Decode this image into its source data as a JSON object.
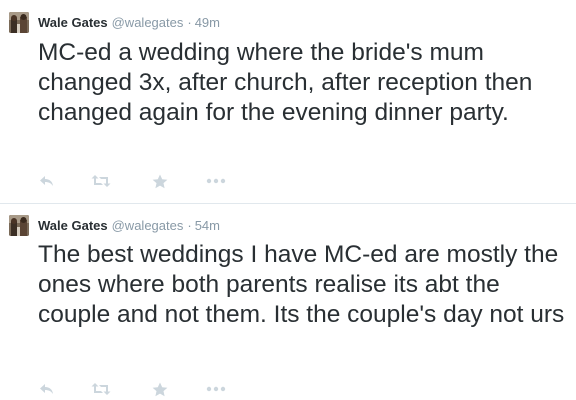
{
  "tweets": [
    {
      "fullname": "Wale Gates",
      "username": "@walegates",
      "separator": "·",
      "time": "49m",
      "text": "MC-ed a wedding where the bride's mum changed 3x, after church, after reception then changed again for the evening dinner party.",
      "actions": [
        "reply-icon",
        "retweet-icon",
        "favorite-icon",
        "more-icon"
      ]
    },
    {
      "fullname": "Wale Gates",
      "username": "@walegates",
      "separator": "·",
      "time": "54m",
      "text": "The best weddings I have MC-ed are mostly the ones where both parents realise its abt the couple and not them. Its the couple's day not urs",
      "actions": [
        "reply-icon",
        "retweet-icon",
        "favorite-icon",
        "more-icon"
      ]
    }
  ],
  "colors": {
    "text": "#292f33",
    "muted": "#8899a6",
    "icon": "#ccd6dd",
    "divider": "#e1e8ed"
  }
}
